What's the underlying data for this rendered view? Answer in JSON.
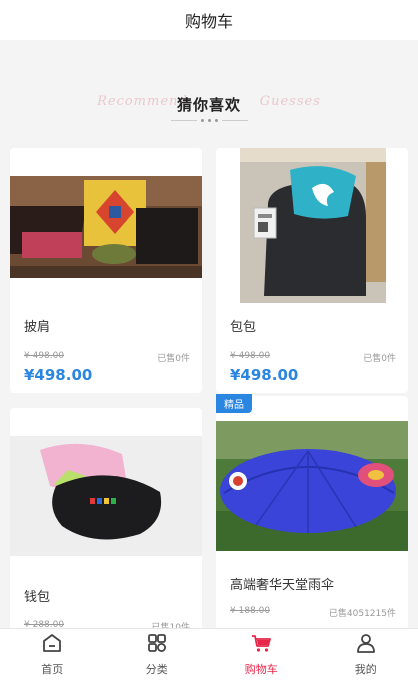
{
  "header": {
    "title": "购物车"
  },
  "section": {
    "heading": "猜你喜欢",
    "bg_script_left": "Recommend",
    "bg_script_right": "Guesses"
  },
  "products": [
    {
      "name": "披肩",
      "original_price": "¥ 498.00",
      "sold": "已售0件",
      "price": "¥498.00",
      "tag": ""
    },
    {
      "name": "包包",
      "original_price": "¥ 498.00",
      "sold": "已售0件",
      "price": "¥498.00",
      "tag": ""
    },
    {
      "name": "钱包",
      "original_price": "¥ 288.00",
      "sold": "已售10件",
      "price": "",
      "tag": ""
    },
    {
      "name": "高端奢华天堂雨伞",
      "original_price": "¥ 188.00",
      "sold": "已售4051215件",
      "price": "",
      "tag": "精品"
    }
  ],
  "tabbar": [
    {
      "label": "首页",
      "icon": "home-icon",
      "active": false
    },
    {
      "label": "分类",
      "icon": "category-grid-icon",
      "active": false
    },
    {
      "label": "购物车",
      "icon": "cart-icon",
      "active": true
    },
    {
      "label": "我的",
      "icon": "user-icon",
      "active": false
    }
  ],
  "colors": {
    "accent": "#2a86e0",
    "active_tab": "#e8264a",
    "background": "#f4f4f4"
  }
}
